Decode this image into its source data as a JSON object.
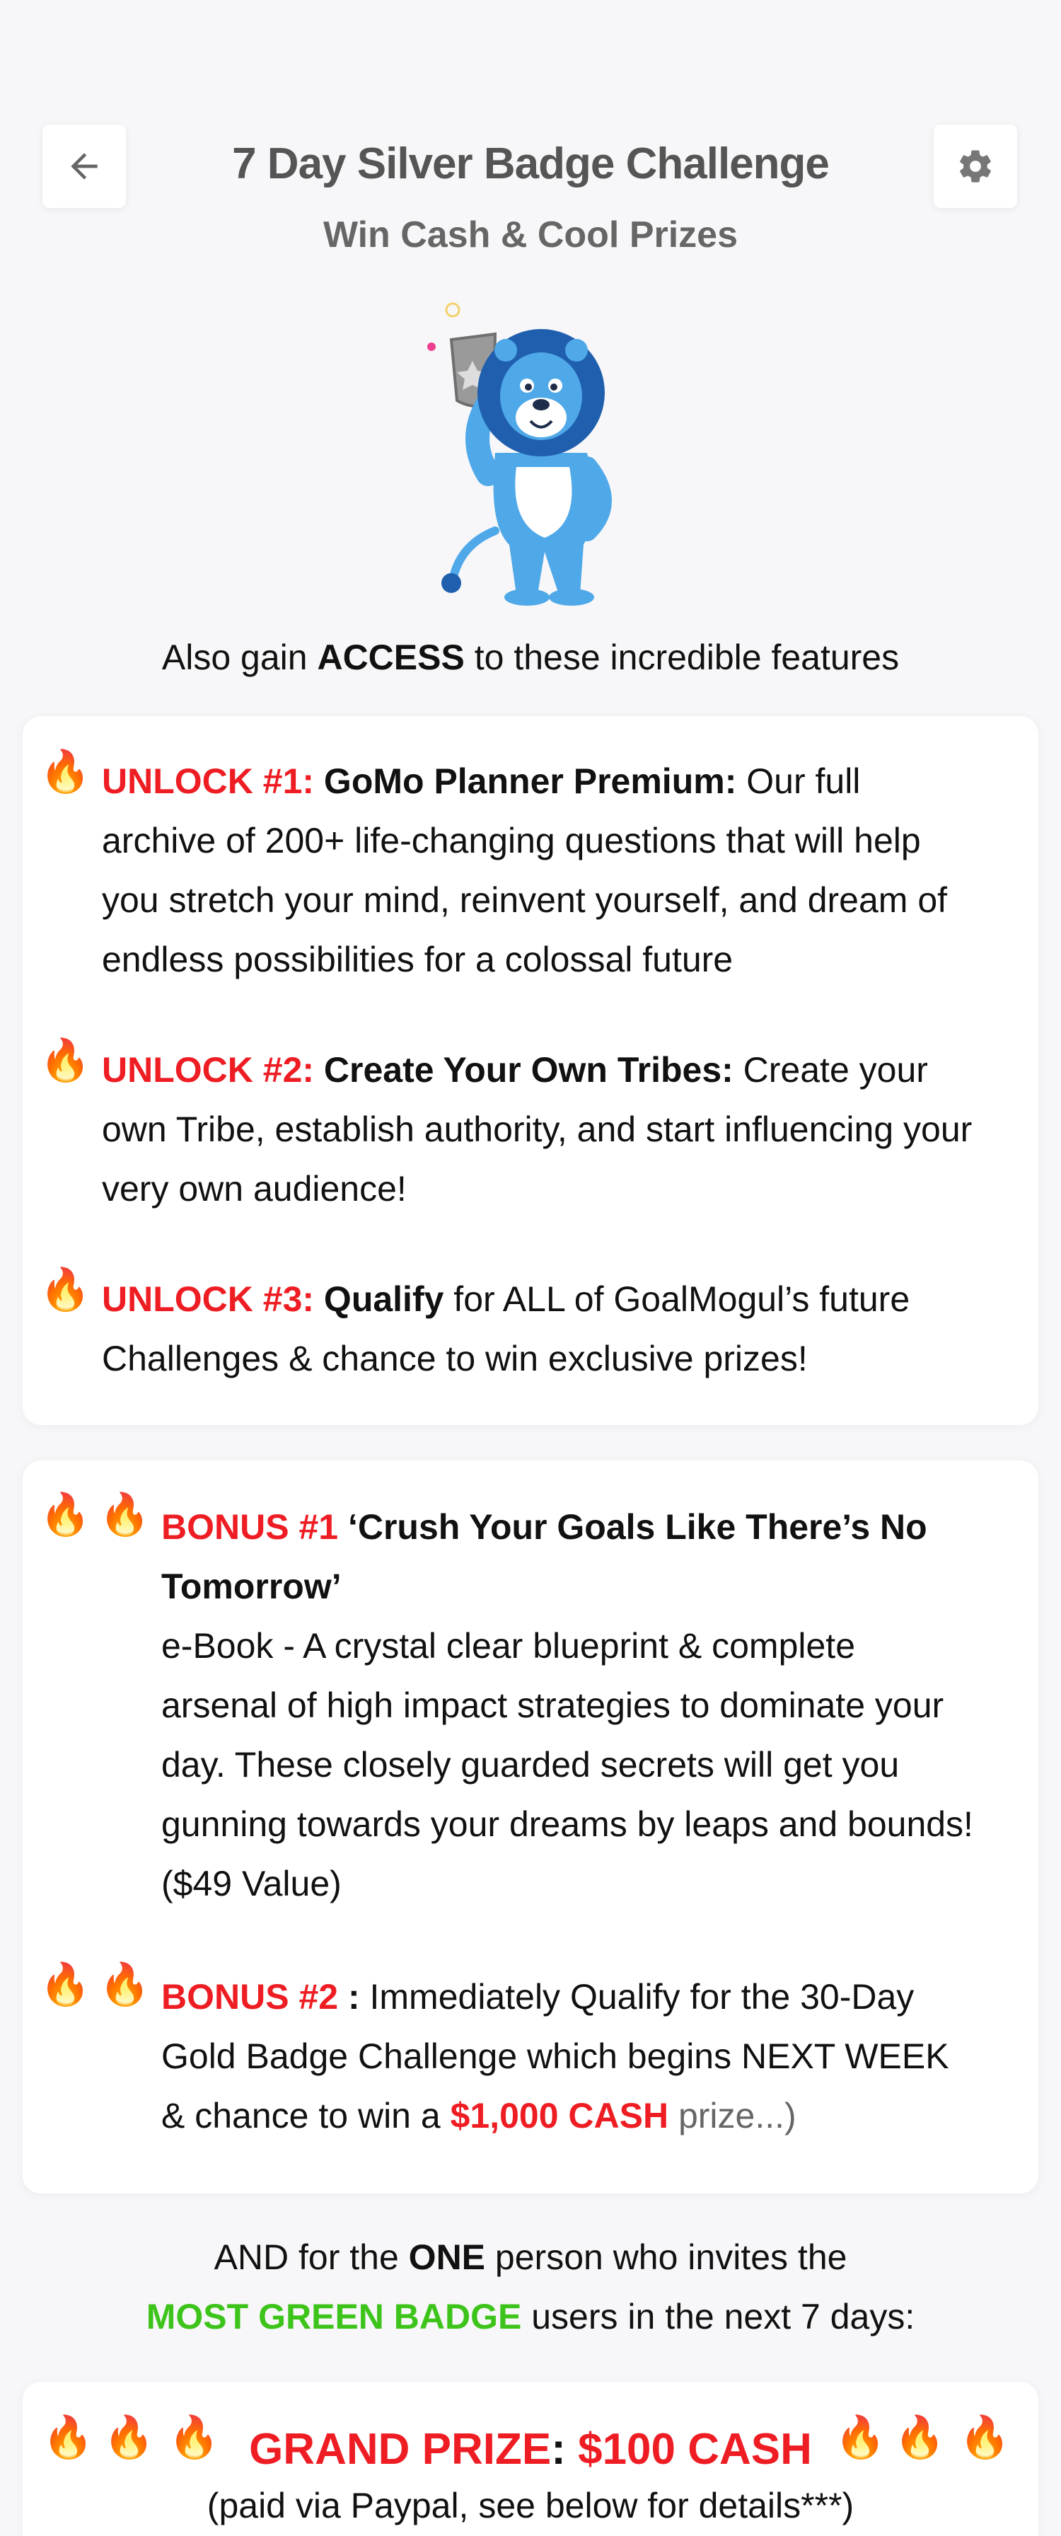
{
  "header": {
    "title": "7 Day Silver Badge Challenge",
    "subtitle": "Win Cash & Cool Prizes"
  },
  "access": {
    "prefix": "Also gain ",
    "emphasis": "ACCESS",
    "suffix": " to these incredible features"
  },
  "unlocks": [
    {
      "tag": "UNLOCK #1:",
      "title": " GoMo Planner Premium:",
      "lines": [
        " Our full",
        "archive of 200+ life-changing questions that will help",
        "you stretch your mind, reinvent yourself, and dream of",
        "endless possibilities for a colossal future"
      ]
    },
    {
      "tag": "UNLOCK #2:",
      "title": " Create Your Own Tribes:",
      "lines": [
        " Create your",
        "own Tribe, establish authority, and start influencing your",
        "very own audience!"
      ]
    },
    {
      "tag": "UNLOCK #3:",
      "title": " Qualify",
      "lines": [
        " for ALL of GoalMogul’s future",
        "Challenges & chance to win exclusive prizes!"
      ]
    }
  ],
  "bonuses": [
    {
      "tag": "BONUS #1",
      "title_line1": " ‘Crush Your Goals Like There’s No",
      "title_line2": "Tomorrow’",
      "lines": [
        "e-Book - A crystal clear blueprint & complete",
        "arsenal of high impact strategies to dominate your",
        "day. These closely guarded secrets will get you",
        "gunning towards your dreams by leaps and bounds!",
        "($49 Value)"
      ]
    },
    {
      "tag": "BONUS #2",
      "sep": " :",
      "line1": " Immediately Qualify for the 30-Day",
      "line2": "Gold  Badge Challenge which begins NEXT WEEK",
      "line3_prefix": "& chance to win a ",
      "cash": "$1,000 CASH",
      "line3_suffix": " prize...)"
    }
  ],
  "invite": {
    "line1_prefix": "AND for the ",
    "line1_bold": "ONE",
    "line1_suffix": " person who invites the",
    "line2_green": "MOST GREEN BADGE",
    "line2_suffix": " users in the next 7 days:"
  },
  "grand_prize": {
    "label": "GRAND PRIZE",
    "colon": ":",
    "amount": " $100 CASH",
    "note": "(paid via Paypal, see below for details***)"
  },
  "icons": {
    "fire": "🔥",
    "back": "arrow-left-icon",
    "settings": "gear-icon"
  },
  "colors": {
    "accent_red": "#ee1d23",
    "accent_green": "#3dc41a",
    "mascot_blue": "#4fa8e8"
  }
}
